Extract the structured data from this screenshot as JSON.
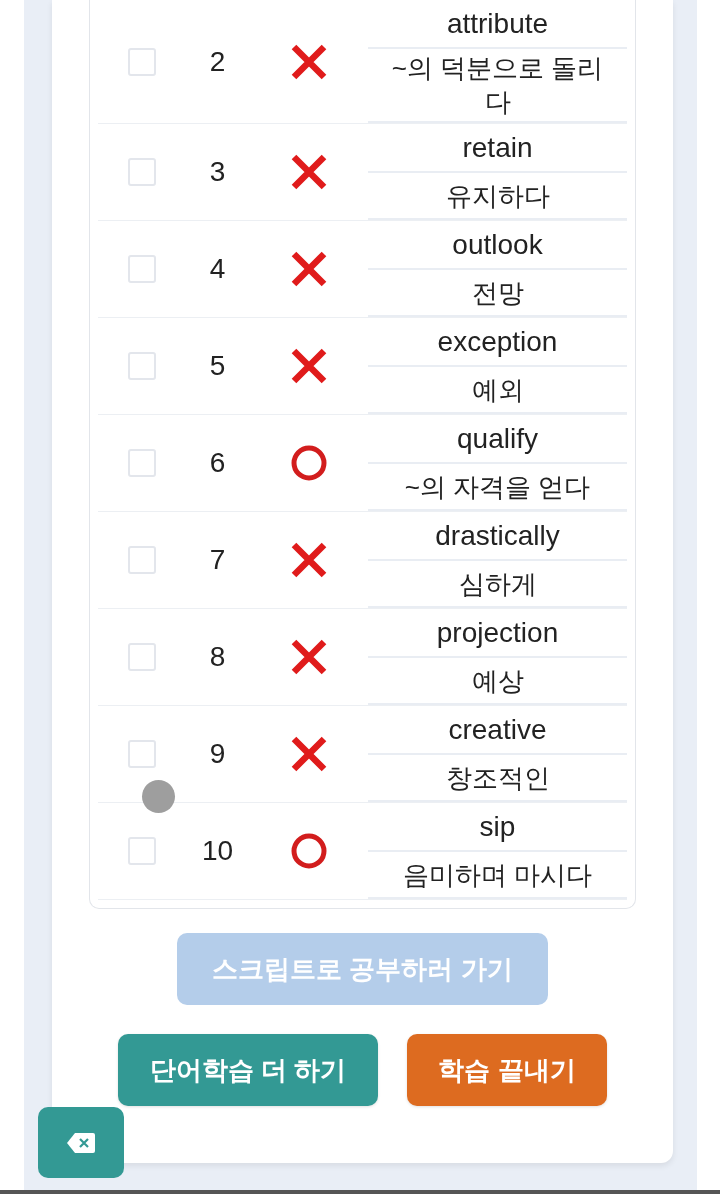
{
  "table": {
    "rows": [
      {
        "checked": false,
        "number": "2",
        "correct": false,
        "english": "attribute",
        "korean": "~의 덕분으로 돌리다"
      },
      {
        "checked": false,
        "number": "3",
        "correct": false,
        "english": "retain",
        "korean": "유지하다"
      },
      {
        "checked": false,
        "number": "4",
        "correct": false,
        "english": "outlook",
        "korean": "전망"
      },
      {
        "checked": false,
        "number": "5",
        "correct": false,
        "english": "exception",
        "korean": "예외"
      },
      {
        "checked": false,
        "number": "6",
        "correct": true,
        "english": "qualify",
        "korean": "~의 자격을 얻다"
      },
      {
        "checked": false,
        "number": "7",
        "correct": false,
        "english": "drastically",
        "korean": "심하게"
      },
      {
        "checked": false,
        "number": "8",
        "correct": false,
        "english": "projection",
        "korean": "예상"
      },
      {
        "checked": false,
        "number": "9",
        "correct": false,
        "english": "creative",
        "korean": "창조적인"
      },
      {
        "checked": false,
        "number": "10",
        "correct": true,
        "english": "sip",
        "korean": "음미하며 마시다"
      }
    ]
  },
  "script_button": {
    "label": "스크립트로 공부하러 가기",
    "disabled": true
  },
  "action_buttons": [
    {
      "label": "단어학습 더 하기",
      "kind": "continue"
    },
    {
      "label": "학습 끝내기",
      "kind": "finish"
    }
  ]
}
